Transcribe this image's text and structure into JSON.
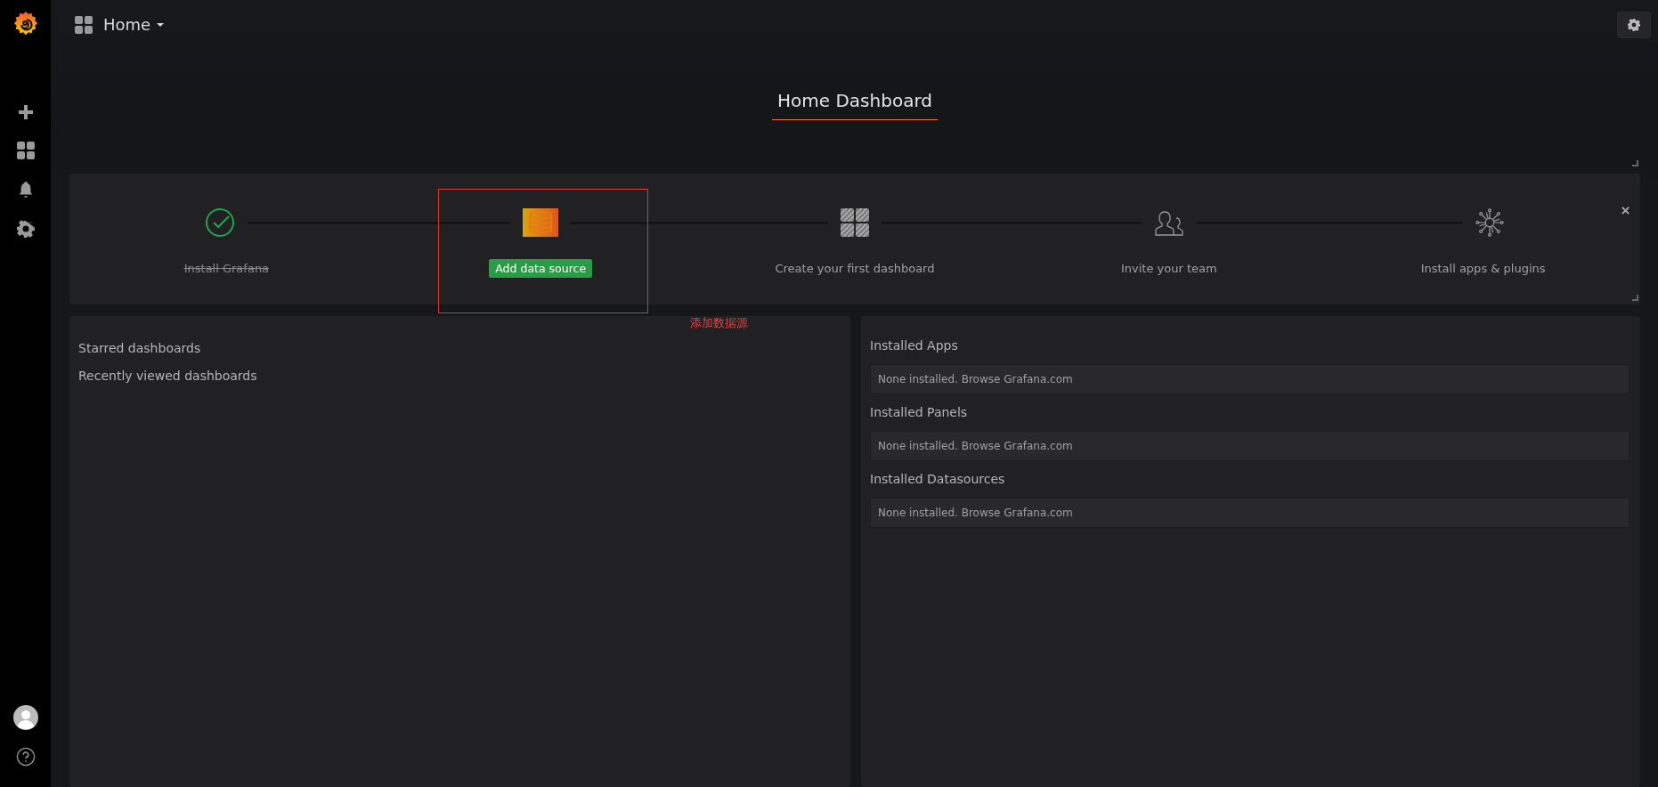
{
  "sidebar": {
    "items": [
      {
        "kind": "create"
      },
      {
        "kind": "dashboards"
      },
      {
        "kind": "alerting"
      },
      {
        "kind": "configuration"
      }
    ]
  },
  "navbar": {
    "title": "Home"
  },
  "dashboard_title": "Home Dashboard",
  "onboarding": {
    "steps": [
      {
        "kind": "done",
        "label": "Install Grafana"
      },
      {
        "kind": "current",
        "label": "Add data source"
      },
      {
        "kind": "todo",
        "label": "Create your first dashboard"
      },
      {
        "kind": "todo",
        "label": "Invite your team"
      },
      {
        "kind": "todo",
        "label": "Install apps & plugins"
      }
    ]
  },
  "annotation": {
    "label": "添加数据源"
  },
  "left_panel": {
    "links": [
      "Starred dashboards",
      "Recently viewed dashboards"
    ]
  },
  "right_panel": {
    "sections": [
      {
        "title": "Installed Apps",
        "empty_text": "None installed. Browse Grafana.com"
      },
      {
        "title": "Installed Panels",
        "empty_text": "None installed. Browse Grafana.com"
      },
      {
        "title": "Installed Datasources",
        "empty_text": "None installed. Browse Grafana.com"
      }
    ]
  }
}
